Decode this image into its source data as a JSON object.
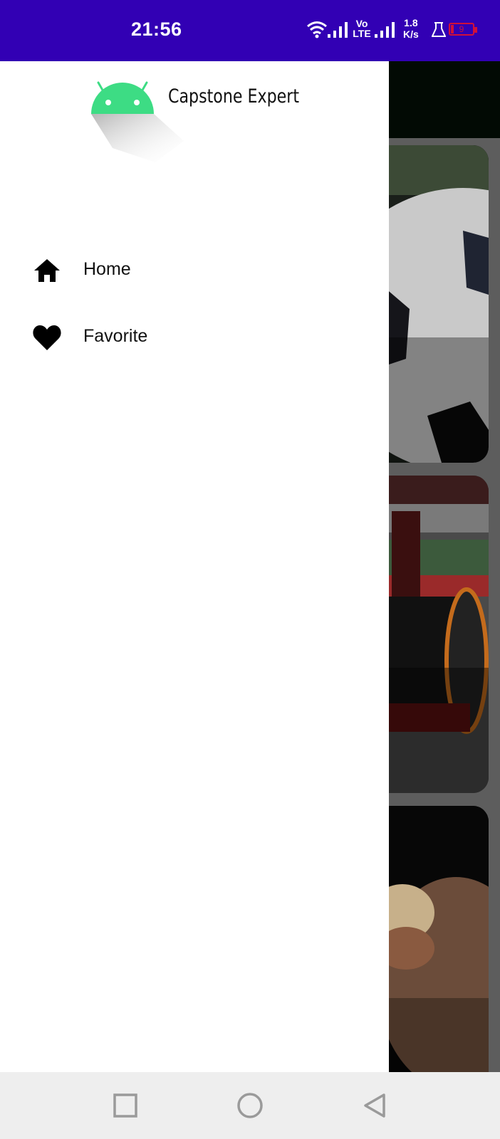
{
  "status_bar": {
    "time": "21:56",
    "network_label_top": "Vo",
    "network_label_bottom": "LTE",
    "speed_value": "1.8",
    "speed_unit": "K/s",
    "battery_level": "9",
    "background_color": "#3200b4",
    "icons": [
      "wifi-icon",
      "signal-icon",
      "volte-icon",
      "signal-icon",
      "lab-flask-icon",
      "battery-low-icon"
    ]
  },
  "drawer": {
    "app_title": "Capstone Expert",
    "logo_icon": "android-icon",
    "logo_color": "#3ddc84",
    "items": [
      {
        "label": "Home",
        "icon": "home-icon"
      },
      {
        "label": "Favorite",
        "icon": "heart-icon"
      }
    ]
  },
  "background_content": {
    "cards": [
      "soccer-card",
      "formula-one-card",
      "boxing-card"
    ]
  },
  "nav_bar": {
    "buttons": [
      "recents-button",
      "home-button",
      "back-button"
    ]
  }
}
